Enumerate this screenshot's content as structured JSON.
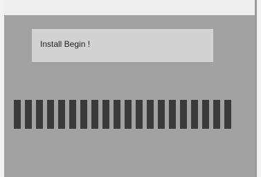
{
  "dialog": {
    "message": "Install Begin !"
  },
  "progress": {
    "segments_filled": 20,
    "fraction": 1.0,
    "segment_color": "#3a3a3a"
  },
  "colors": {
    "screen_background": "#a2a2a2",
    "message_box_background": "#d2d2d2"
  }
}
